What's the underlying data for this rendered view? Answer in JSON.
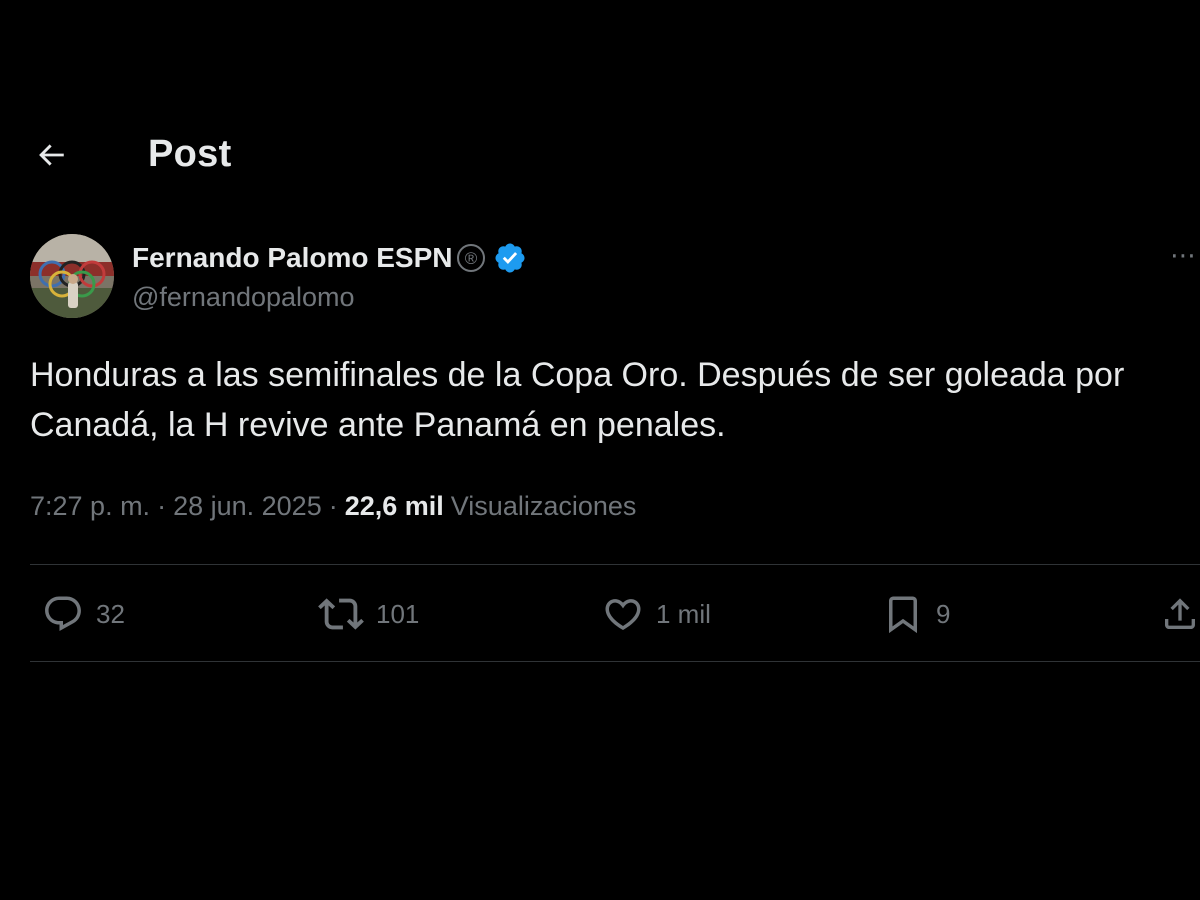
{
  "header": {
    "back_icon": "arrow-left-icon",
    "title": "Post"
  },
  "author": {
    "display_name": "Fernando Palomo ESPN",
    "registered_mark": "®",
    "verified_icon": "verified-badge-icon",
    "verified_color": "#1d9bf0",
    "handle": "@fernandopalomo",
    "more_label": "⋯"
  },
  "post": {
    "text": "Honduras a las semifinales de la Copa Oro. Después de ser goleada por\nCanadá, la H revive ante Panamá en penales."
  },
  "meta": {
    "time": "7:27 p. m.",
    "separator": "·",
    "date": "28 jun. 2025",
    "views_count": "22,6 mil",
    "views_label": "Visualizaciones"
  },
  "actions": {
    "replies": {
      "icon": "reply-icon",
      "count": "32"
    },
    "reposts": {
      "icon": "repost-icon",
      "count": "101"
    },
    "likes": {
      "icon": "heart-icon",
      "count": "1 mil"
    },
    "bookmarks": {
      "icon": "bookmark-icon",
      "count": "9"
    },
    "share": {
      "icon": "share-icon"
    }
  },
  "colors": {
    "background": "#000000",
    "text_primary": "#e7e9ea",
    "text_secondary": "#71767b",
    "divider": "#2f3336"
  }
}
